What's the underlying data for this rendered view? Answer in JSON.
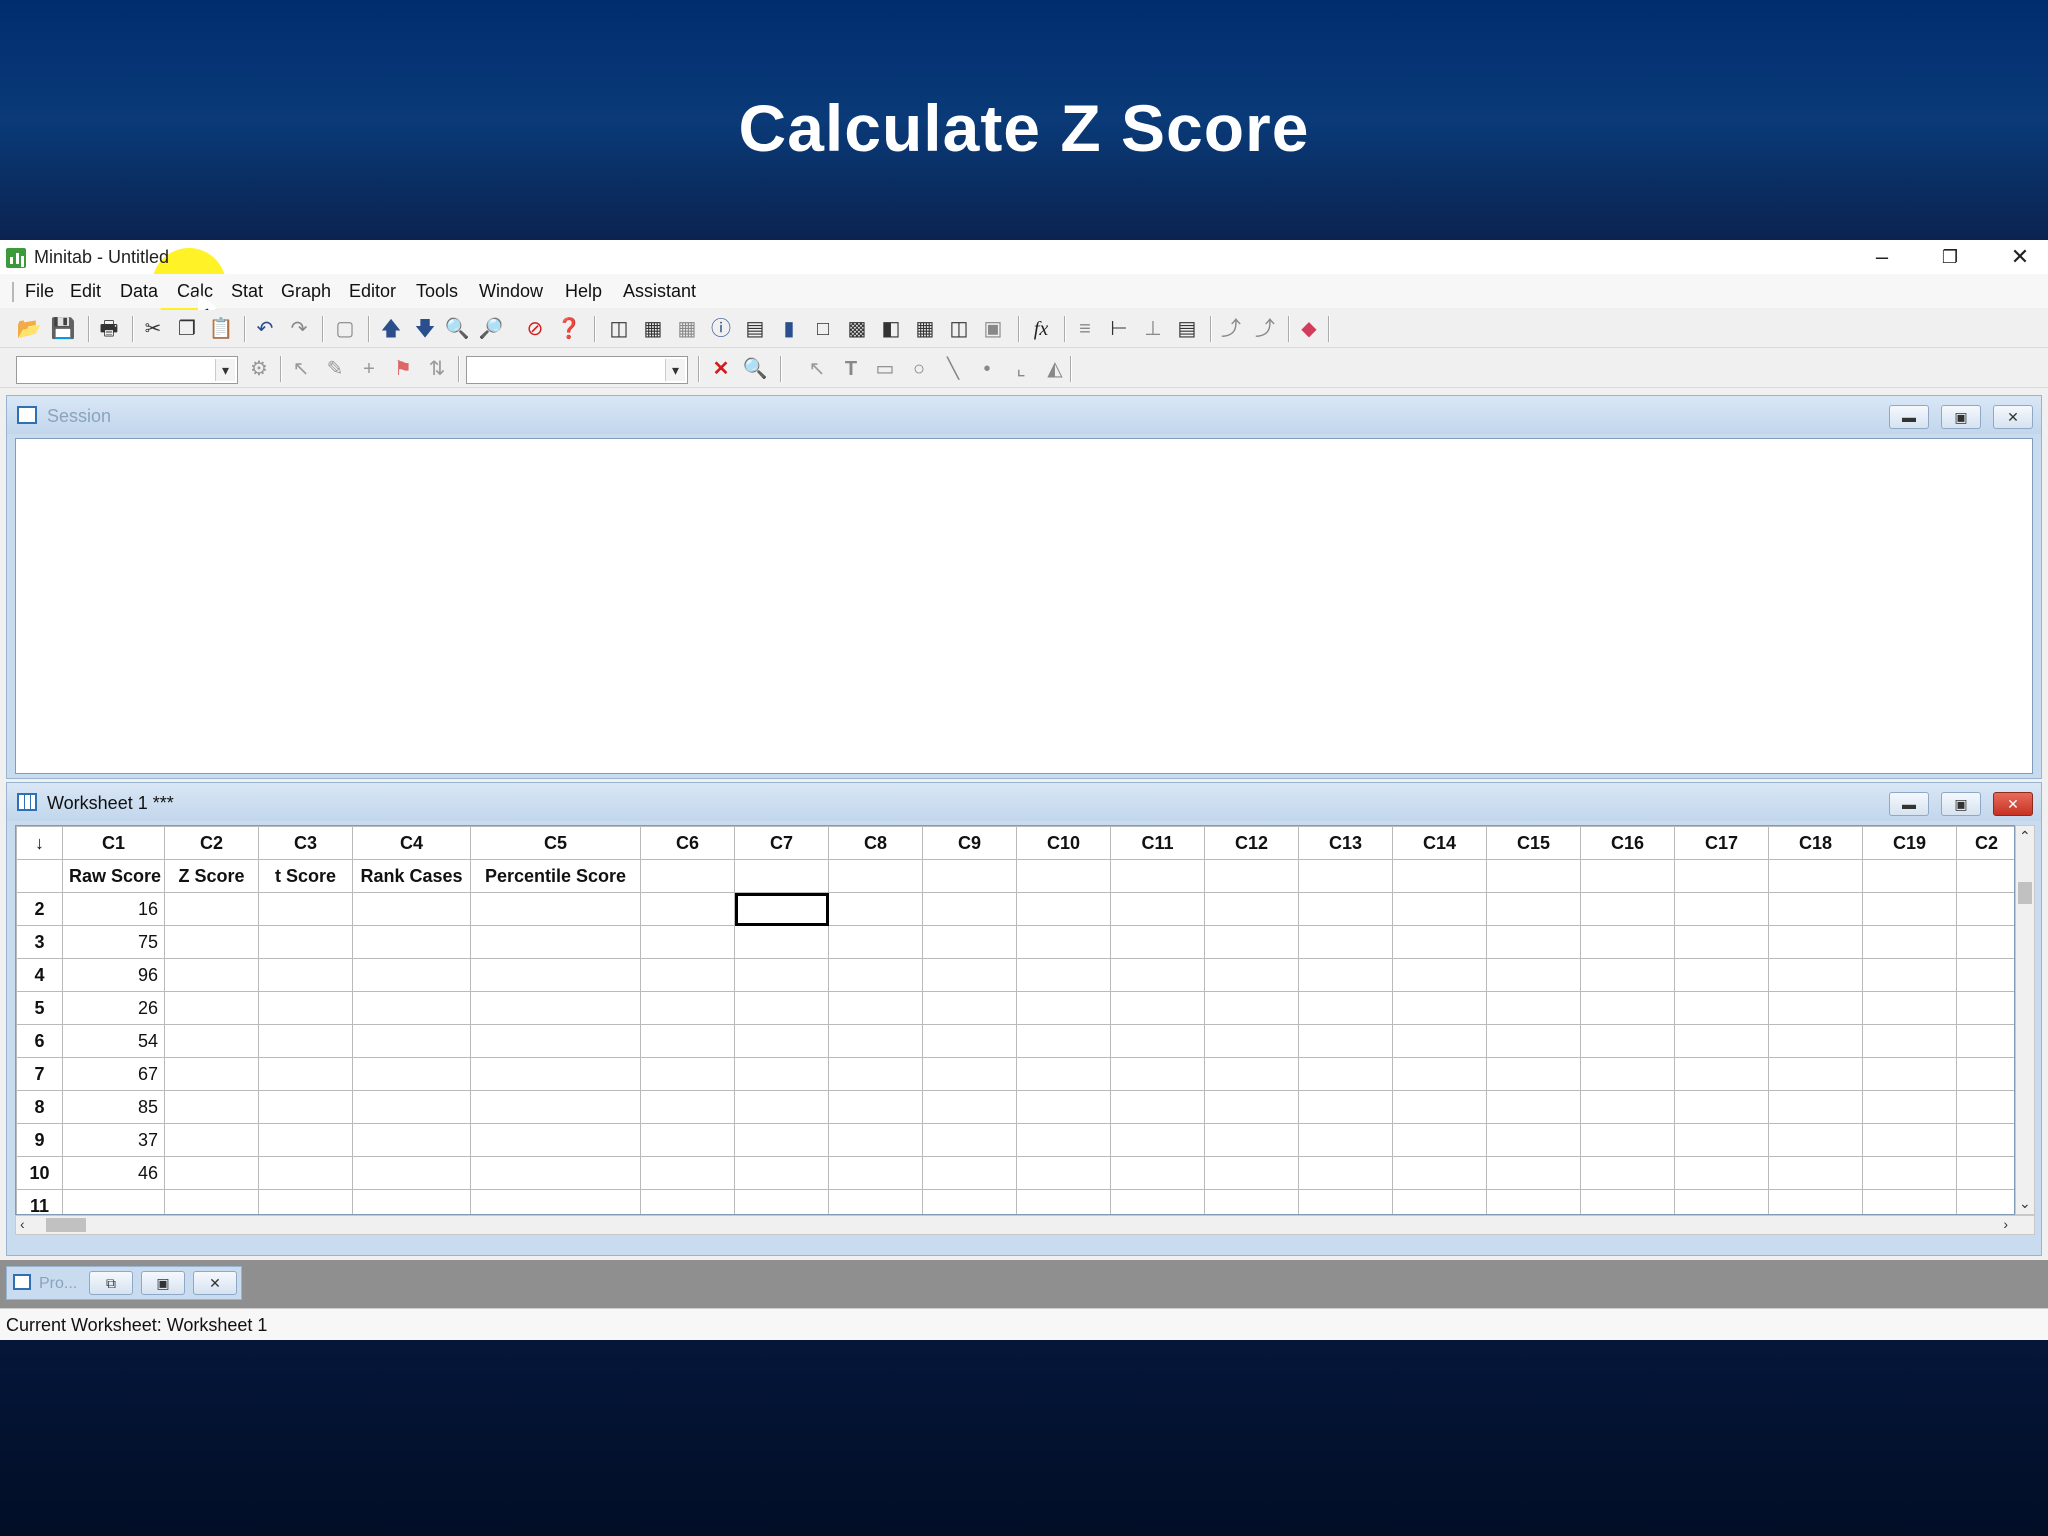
{
  "slide_title": "Calculate Z Score",
  "window": {
    "title": "Minitab - Untitled",
    "minimize": "–",
    "restore": "❐",
    "close": "✕"
  },
  "menu": [
    "File",
    "Edit",
    "Data",
    "Calc",
    "Stat",
    "Graph",
    "Editor",
    "Tools",
    "Window",
    "Help",
    "Assistant"
  ],
  "session": {
    "title": "Session"
  },
  "worksheet": {
    "title": "Worksheet 1 ***",
    "corner": "↓",
    "columns": [
      "C1",
      "C2",
      "C3",
      "C4",
      "C5",
      "C6",
      "C7",
      "C8",
      "C9",
      "C10",
      "C11",
      "C12",
      "C13",
      "C14",
      "C15",
      "C16",
      "C17",
      "C18",
      "C19",
      "C2"
    ],
    "column_names": [
      "Raw Score",
      "Z Score",
      "t Score",
      "Rank Cases",
      "Percentile Score",
      "",
      "",
      "",
      "",
      "",
      "",
      "",
      "",
      "",
      "",
      "",
      "",
      "",
      "",
      ""
    ],
    "rows": [
      {
        "n": "2",
        "c1": "16"
      },
      {
        "n": "3",
        "c1": "75"
      },
      {
        "n": "4",
        "c1": "96"
      },
      {
        "n": "5",
        "c1": "26"
      },
      {
        "n": "6",
        "c1": "54"
      },
      {
        "n": "7",
        "c1": "67"
      },
      {
        "n": "8",
        "c1": "85"
      },
      {
        "n": "9",
        "c1": "37"
      },
      {
        "n": "10",
        "c1": "46"
      },
      {
        "n": "11",
        "c1": ""
      }
    ]
  },
  "project": {
    "label": "Pro..."
  },
  "status": "Current Worksheet: Worksheet 1",
  "icons": [
    "open-icon",
    "save-icon",
    "print-icon",
    "cut-icon",
    "copy-icon",
    "paste-icon",
    "undo-icon",
    "redo-icon",
    "stop-icon",
    "help-icon",
    "fx-icon",
    "eraser-icon"
  ]
}
